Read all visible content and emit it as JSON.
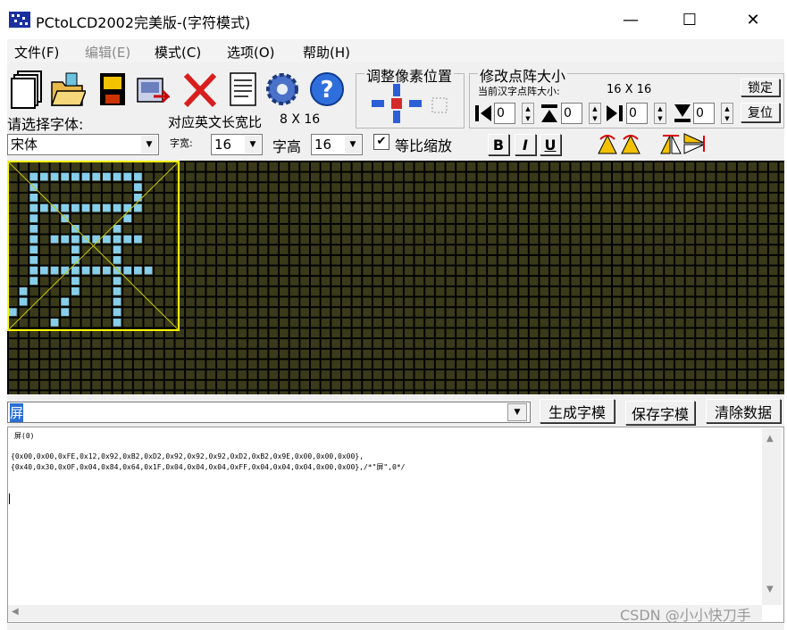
{
  "window": {
    "title": "PCtoLCD2002完美版-(字符模式)",
    "minimize_glyph": "—",
    "maximize_glyph": "☐",
    "close_glyph": "✕"
  },
  "menu": [
    "文件(F)",
    "编辑(E)",
    "模式(C)",
    "选项(O)",
    "帮助(H)"
  ],
  "toolbar": {
    "icons": [
      "new-file-icon",
      "open-folder-icon",
      "save-disk-icon",
      "export-icon",
      "delete-x-icon",
      "notepad-icon",
      "settings-gear-icon",
      "help-question-icon"
    ],
    "adjust_pixel_label": "调整像素位置",
    "resize_group_label": "修改点阵大小",
    "current_size_label": "当前汉字点阵大小:",
    "current_size_value": "16 X 16",
    "lock_label": "锁定",
    "reset_label": "复位",
    "spin_values": [
      "0",
      "0",
      "0",
      "0"
    ],
    "font_select_label": "请选择字体:",
    "en_ratio_label": "对应英文长宽比",
    "en_ratio_value": "8 X 16",
    "font_name": "宋体",
    "char_width_label": "字宽:",
    "char_width_value": "16",
    "char_height_label": "字高",
    "char_height_value": "16",
    "proportional_label": "等比缩放",
    "proportional_checked": true,
    "bold_label": "B",
    "italic_label": "I",
    "underline_label": "U"
  },
  "grid": {
    "cell_color": "#3a3a1a",
    "lit_color": "#87ceeb",
    "frame_color": "#ffff00",
    "character": "屏"
  },
  "bottom": {
    "input_char": "屏",
    "generate_label": "生成字模",
    "save_label": "保存字模",
    "clear_label": "清除数据",
    "output_header": "屏(0)",
    "output_line1": "{0x00,0x00,0xFE,0x12,0x92,0xB2,0xD2,0x92,0x92,0x92,0xD2,0xB2,0x9E,0x00,0x00,0x00},",
    "output_line2": "{0x40,0x30,0x0F,0x04,0x84,0x64,0x1F,0x04,0x04,0x04,0xFF,0x04,0x04,0x04,0x00,0x00},/*\"屏\",0*/"
  },
  "watermark": "CSDN @小小快刀手"
}
